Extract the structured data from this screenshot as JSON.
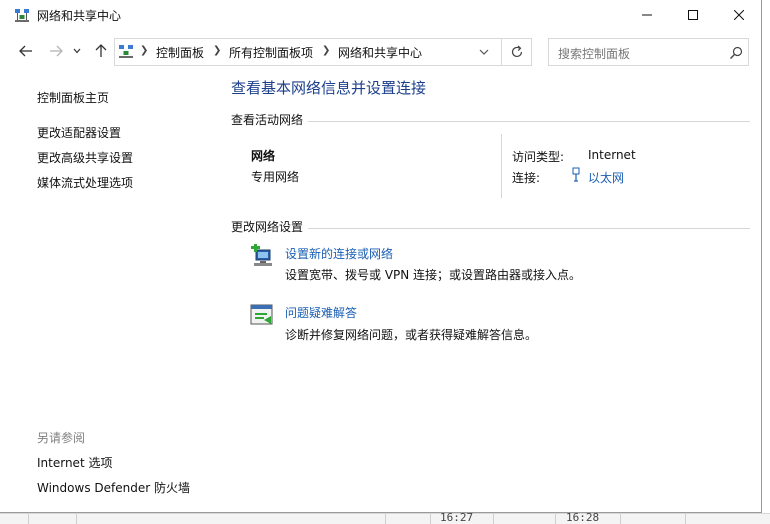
{
  "window": {
    "title": "网络和共享中心"
  },
  "navigation": {
    "breadcrumbs": [
      "控制面板",
      "所有控制面板项",
      "网络和共享中心"
    ]
  },
  "search": {
    "placeholder": "搜索控制面板"
  },
  "sidebar": {
    "home_link": "控制面板主页",
    "links": [
      "更改适配器设置",
      "更改高级共享设置",
      "媒体流式处理选项"
    ],
    "see_also_heading": "另请参阅",
    "see_also_links": [
      "Internet 选项",
      "Windows Defender 防火墙"
    ]
  },
  "main": {
    "title": "查看基本网络信息并设置连接",
    "active_networks_label": "查看活动网络",
    "network": {
      "name": "网络",
      "category": "专用网络",
      "access_type_label": "访问类型:",
      "access_type_value": "Internet",
      "connections_label": "连接:",
      "connection_name": "以太网"
    },
    "change_settings_label": "更改网络设置",
    "tasks": [
      {
        "icon": "network-setup-icon",
        "link": "设置新的连接或网络",
        "description": "设置宽带、拨号或 VPN 连接；或设置路由器或接入点。"
      },
      {
        "icon": "troubleshoot-icon",
        "link": "问题疑难解答",
        "description": "诊断并修复网络问题，或者获得疑难解答信息。"
      }
    ]
  },
  "background": {
    "times": [
      "16:27",
      "16:28"
    ]
  },
  "colors": {
    "title_blue": "#1d3f8c",
    "link_blue": "#1a5fb4"
  }
}
